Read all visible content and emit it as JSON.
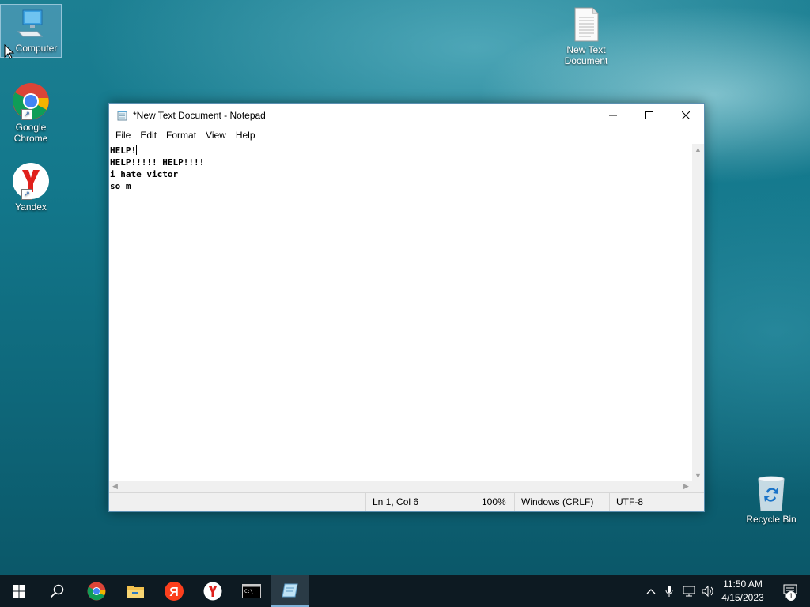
{
  "desktop": {
    "icons": [
      {
        "label": "Computer",
        "icon": "computer-icon"
      },
      {
        "label": "Google Chrome",
        "icon": "chrome-icon"
      },
      {
        "label": "Yandex",
        "icon": "yandex-browser-icon"
      },
      {
        "label": "New Text Document",
        "icon": "text-document-icon"
      },
      {
        "label": "Recycle Bin",
        "icon": "recycle-bin-icon"
      }
    ]
  },
  "notepad": {
    "title": "*New Text Document - Notepad",
    "menu": [
      "File",
      "Edit",
      "Format",
      "View",
      "Help"
    ],
    "lines": [
      "HELP!",
      "HELP!!!!! HELP!!!!",
      "i hate victor",
      "so m"
    ],
    "status": {
      "position": "Ln 1, Col 6",
      "zoom": "100%",
      "line_ending": "Windows (CRLF)",
      "encoding": "UTF-8"
    }
  },
  "taskbar": {
    "apps": [
      "start-icon",
      "search-icon",
      "chrome-icon",
      "file-explorer-icon",
      "yandex-icon",
      "yandex-browser-icon",
      "terminal-icon",
      "notepad-icon"
    ],
    "clock": {
      "time": "11:50 AM",
      "date": "4/15/2023"
    },
    "notification_count": "1"
  },
  "colors": {
    "taskbar": "#0d1a22",
    "desktop": "#13788c",
    "window_border": "#5a8fb0"
  }
}
